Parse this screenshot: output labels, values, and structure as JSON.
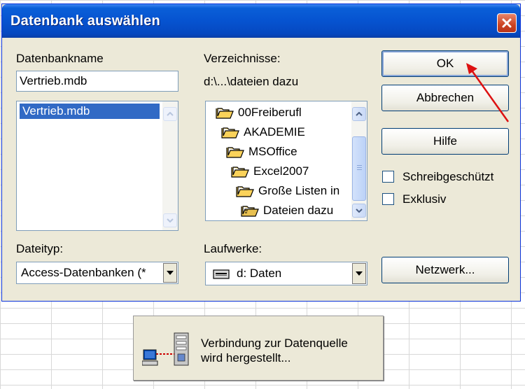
{
  "dialog": {
    "title": "Datenbank auswählen",
    "accent": "#0a5fd8",
    "close_icon": "close-icon"
  },
  "database": {
    "label": "Datenbankname",
    "value": "Vertrieb.mdb",
    "files": [
      "Vertrieb.mdb"
    ],
    "selected_file": "Vertrieb.mdb"
  },
  "directories": {
    "label": "Verzeichnisse:",
    "current_path": "d:\\...\\dateien dazu",
    "folders": [
      {
        "name": "00Freiberufl",
        "icon": "folder-open-icon"
      },
      {
        "name": "AKADEMIE",
        "icon": "folder-open-icon"
      },
      {
        "name": "MSOffice",
        "icon": "folder-open-icon"
      },
      {
        "name": "Excel2007",
        "icon": "folder-open-icon"
      },
      {
        "name": "Große Listen in",
        "icon": "folder-open-icon"
      },
      {
        "name": "Dateien dazu",
        "icon": "folder-open-icon"
      }
    ]
  },
  "filetype": {
    "label": "Dateityp:",
    "value": "Access-Datenbanken (*"
  },
  "drives": {
    "label": "Laufwerke:",
    "value": "d: Daten",
    "icon": "drive-icon"
  },
  "buttons": {
    "ok": "OK",
    "cancel": "Abbrechen",
    "help": "Hilfe",
    "network": "Netzwerk..."
  },
  "options": {
    "readonly": {
      "label": "Schreibgeschützt",
      "checked": false
    },
    "exclusive": {
      "label": "Exklusiv",
      "checked": false
    }
  },
  "status_popup": {
    "line1": "Verbindung zur Datenquelle",
    "line2": "wird hergestellt...",
    "icon": "network-connection-icon"
  },
  "annotation": {
    "arrow_color": "#dd1111",
    "icon": "red-arrow-icon"
  }
}
